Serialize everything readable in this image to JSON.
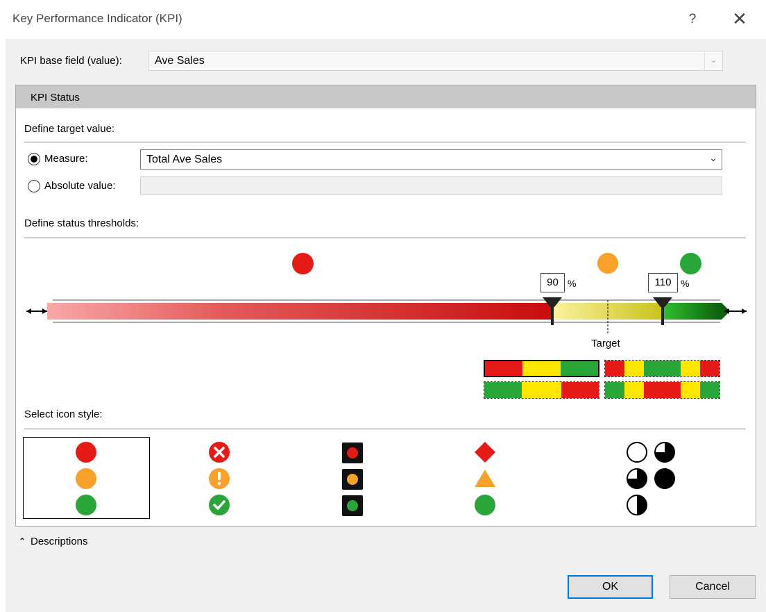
{
  "window": {
    "title": "Key Performance Indicator (KPI)",
    "help_label": "?",
    "close_label": "✕"
  },
  "base_field": {
    "label": "KPI base field (value):",
    "value": "Ave Sales",
    "arrow": "⌄"
  },
  "kpi_status": {
    "header": "KPI Status",
    "target_section": "Define target value:",
    "measure_label": "Measure:",
    "measure_value": "Total Ave Sales",
    "measure_arrow": "⌄",
    "measure_selected": true,
    "absolute_label": "Absolute value:",
    "absolute_value": ""
  },
  "thresholds": {
    "section_label": "Define status thresholds:",
    "low": "90",
    "high": "110",
    "percent_sign": "%",
    "target_label": "Target",
    "status_colors": {
      "red": "#e41b17",
      "yellow": "#f7a12b",
      "green": "#2aa53a"
    }
  },
  "icon_style": {
    "section_label": "Select icon style:",
    "selected_index": 0,
    "sets": [
      [
        "circle-red-icon",
        "circle-yellow-icon",
        "circle-green-icon"
      ],
      [
        "x-circle-red-icon",
        "exclamation-circle-yellow-icon",
        "check-circle-green-icon"
      ],
      [
        "traffic-light-red-icon",
        "traffic-light-yellow-icon",
        "traffic-light-green-icon"
      ],
      [
        "diamond-red-icon",
        "triangle-yellow-icon",
        "circle-green-icon"
      ],
      [
        "pie-empty-icon",
        "pie-three-quarter-icon",
        "pie-quarter-icon",
        "pie-full-icon",
        "pie-half-icon"
      ]
    ]
  },
  "footer": {
    "descriptions_label": "Descriptions",
    "descriptions_icon": "double-chevron-up-icon",
    "ok_label": "OK",
    "cancel_label": "Cancel"
  }
}
